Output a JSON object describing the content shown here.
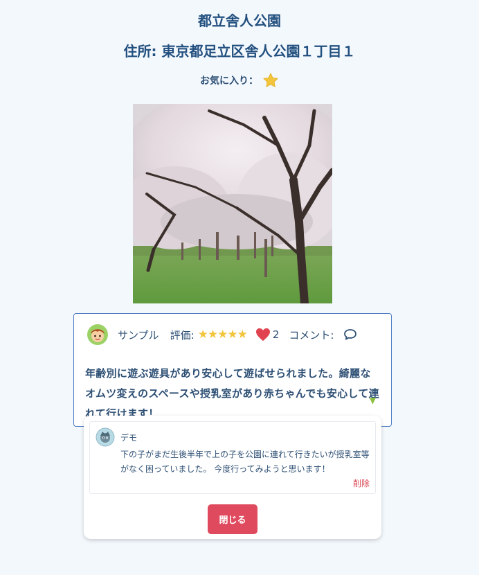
{
  "park": {
    "name": "都立舎人公園",
    "address": "住所: 東京都足立区舎人公園１丁目１",
    "favorite_label": "お気に入り：",
    "favorite": true
  },
  "review": {
    "reviewer_name": "サンプル",
    "rating_label": "評価:",
    "rating": 5,
    "rating_stars": "★★★★★",
    "like_count": "2",
    "comment_label": "コメント:",
    "text": "年齢別に遊ぶ遊具があり安心して遊ばせられました。綺麗なオムツ変えのスペースや授乳室があり赤ちゃんでも安心して連れて行けます！",
    "expand_glyph": "▼"
  },
  "comments": [
    {
      "name": "デモ",
      "text": "下の子がまだ生後半年で上の子を公園に連れて行きたいが授乳室等がなく困っていました。 今度行ってみようと思います！",
      "delete_label": "削除"
    }
  ],
  "panel": {
    "close_label": "閉じる"
  },
  "colors": {
    "title": "#23507f",
    "star": "#f2c53c",
    "heart": "#e0424f",
    "card_border": "#4a78c2",
    "close_button": "#e04a5e",
    "delete": "#d9434f",
    "page_bg": "#f3f8fd"
  },
  "icons": {
    "favorite": "star-icon",
    "like": "heart-icon",
    "comment": "speech-bubble-icon",
    "expand": "triangle-down-icon"
  }
}
